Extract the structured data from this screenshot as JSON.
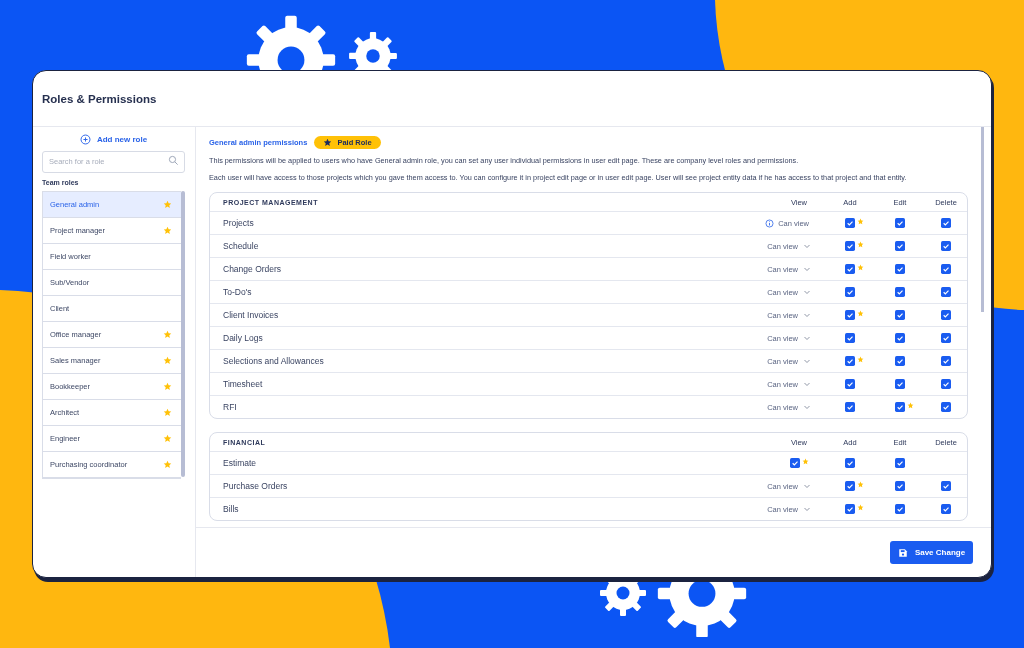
{
  "window": {
    "title": "Roles & Permissions"
  },
  "sidebar": {
    "add_button": "Add new role",
    "search": {
      "placeholder": "Search for a role"
    },
    "heading": "Team roles",
    "roles": [
      {
        "name": "General admin",
        "selected": true,
        "paid": true
      },
      {
        "name": "Project manager",
        "selected": false,
        "paid": true
      },
      {
        "name": "Field worker",
        "selected": false,
        "paid": false
      },
      {
        "name": "Sub/Vendor",
        "selected": false,
        "paid": false
      },
      {
        "name": "Client",
        "selected": false,
        "paid": false
      },
      {
        "name": "Office manager",
        "selected": false,
        "paid": true
      },
      {
        "name": "Sales manager",
        "selected": false,
        "paid": true
      },
      {
        "name": "Bookkeeper",
        "selected": false,
        "paid": true
      },
      {
        "name": "Architect",
        "selected": false,
        "paid": true
      },
      {
        "name": "Engineer",
        "selected": false,
        "paid": true
      },
      {
        "name": "Purchasing coordinator",
        "selected": false,
        "paid": true
      }
    ]
  },
  "main": {
    "heading": "General admin permissions",
    "badge": "Paid Role",
    "notes": [
      "This permissions will be applied to users who have General admin role, you can set any user individual permissions in user edit page. These are company level roles and permissions.",
      "Each user will have access to those projects which you gave them access to. You can configure it in project edit page or in user edit page. User will see project entity data if he has access to that project and that entity."
    ],
    "sections": [
      {
        "title": "PROJECT MANAGEMENT",
        "columns": [
          "View",
          "Add",
          "Edit",
          "Delete"
        ],
        "rows": [
          {
            "name": "Projects",
            "cells": [
              {
                "kind": "info",
                "text": "Can view"
              },
              {
                "kind": "checkbox",
                "checked": true,
                "paid": true
              },
              {
                "kind": "checkbox",
                "checked": true,
                "paid": false
              },
              {
                "kind": "checkbox",
                "checked": true,
                "paid": false
              }
            ]
          },
          {
            "name": "Schedule",
            "cells": [
              {
                "kind": "dropdown",
                "text": "Can view"
              },
              {
                "kind": "checkbox",
                "checked": true,
                "paid": true
              },
              {
                "kind": "checkbox",
                "checked": true,
                "paid": false
              },
              {
                "kind": "checkbox",
                "checked": true,
                "paid": false
              }
            ]
          },
          {
            "name": "Change Orders",
            "cells": [
              {
                "kind": "dropdown",
                "text": "Can view"
              },
              {
                "kind": "checkbox",
                "checked": true,
                "paid": true
              },
              {
                "kind": "checkbox",
                "checked": true,
                "paid": false
              },
              {
                "kind": "checkbox",
                "checked": true,
                "paid": false
              }
            ]
          },
          {
            "name": "To-Do's",
            "cells": [
              {
                "kind": "dropdown",
                "text": "Can view"
              },
              {
                "kind": "checkbox",
                "checked": true,
                "paid": false
              },
              {
                "kind": "checkbox",
                "checked": true,
                "paid": false
              },
              {
                "kind": "checkbox",
                "checked": true,
                "paid": false
              }
            ]
          },
          {
            "name": "Client Invoices",
            "cells": [
              {
                "kind": "dropdown",
                "text": "Can view"
              },
              {
                "kind": "checkbox",
                "checked": true,
                "paid": true
              },
              {
                "kind": "checkbox",
                "checked": true,
                "paid": false
              },
              {
                "kind": "checkbox",
                "checked": true,
                "paid": false
              }
            ]
          },
          {
            "name": "Daily Logs",
            "cells": [
              {
                "kind": "dropdown",
                "text": "Can view"
              },
              {
                "kind": "checkbox",
                "checked": true,
                "paid": false
              },
              {
                "kind": "checkbox",
                "checked": true,
                "paid": false
              },
              {
                "kind": "checkbox",
                "checked": true,
                "paid": false
              }
            ]
          },
          {
            "name": "Selections and Allowances",
            "cells": [
              {
                "kind": "dropdown",
                "text": "Can view"
              },
              {
                "kind": "checkbox",
                "checked": true,
                "paid": true
              },
              {
                "kind": "checkbox",
                "checked": true,
                "paid": false
              },
              {
                "kind": "checkbox",
                "checked": true,
                "paid": false
              }
            ]
          },
          {
            "name": "Timesheet",
            "cells": [
              {
                "kind": "dropdown",
                "text": "Can view"
              },
              {
                "kind": "checkbox",
                "checked": true,
                "paid": false
              },
              {
                "kind": "checkbox",
                "checked": true,
                "paid": false
              },
              {
                "kind": "checkbox",
                "checked": true,
                "paid": false
              }
            ]
          },
          {
            "name": "RFI",
            "cells": [
              {
                "kind": "dropdown",
                "text": "Can view"
              },
              {
                "kind": "checkbox",
                "checked": true,
                "paid": false
              },
              {
                "kind": "checkbox",
                "checked": true,
                "paid": true
              },
              {
                "kind": "checkbox",
                "checked": true,
                "paid": false
              }
            ]
          }
        ]
      },
      {
        "title": "FINANCIAL",
        "columns": [
          "View",
          "Add",
          "Edit",
          "Delete"
        ],
        "rows": [
          {
            "name": "Estimate",
            "cells": [
              {
                "kind": "checkbox",
                "checked": true,
                "paid": true
              },
              {
                "kind": "checkbox",
                "checked": true,
                "paid": false
              },
              {
                "kind": "checkbox",
                "checked": true,
                "paid": false
              }
            ]
          },
          {
            "name": "Purchase Orders",
            "cells": [
              {
                "kind": "dropdown",
                "text": "Can view"
              },
              {
                "kind": "checkbox",
                "checked": true,
                "paid": true
              },
              {
                "kind": "checkbox",
                "checked": true,
                "paid": false
              },
              {
                "kind": "checkbox",
                "checked": true,
                "paid": false
              }
            ]
          },
          {
            "name": "Bills",
            "cells": [
              {
                "kind": "dropdown",
                "text": "Can view"
              },
              {
                "kind": "checkbox",
                "checked": true,
                "paid": true
              },
              {
                "kind": "checkbox",
                "checked": true,
                "paid": false
              },
              {
                "kind": "checkbox",
                "checked": true,
                "paid": false
              }
            ]
          }
        ]
      }
    ]
  },
  "footer": {
    "save_button": "Save Change"
  }
}
